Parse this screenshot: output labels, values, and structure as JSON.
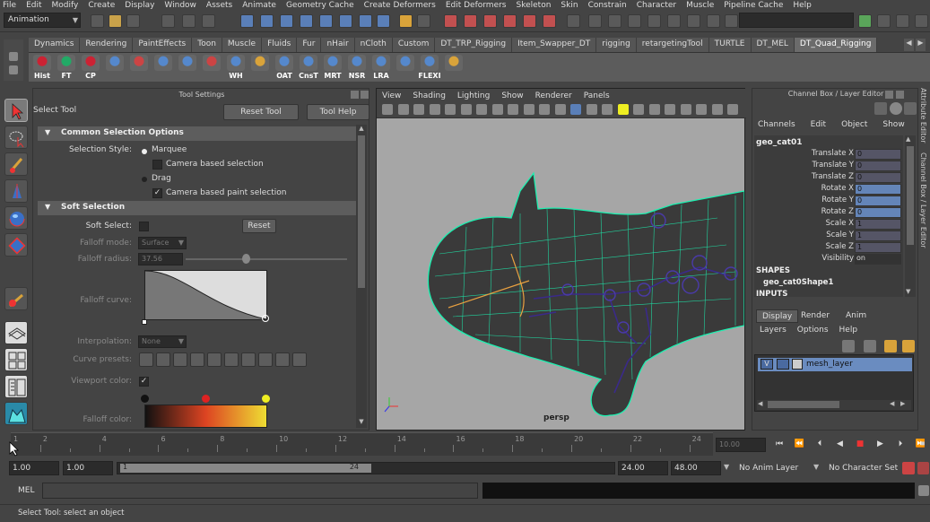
{
  "menubar": [
    "File",
    "Edit",
    "Modify",
    "Create",
    "Display",
    "Window",
    "Assets",
    "Animate",
    "Geometry Cache",
    "Create Deformers",
    "Edit Deformers",
    "Skeleton",
    "Skin",
    "Constrain",
    "Character",
    "Muscle",
    "Pipeline Cache",
    "Help"
  ],
  "status": {
    "mode": "Animation"
  },
  "shelf_tabs": [
    "Dynamics",
    "Rendering",
    "PaintEffects",
    "Toon",
    "Muscle",
    "Fluids",
    "Fur",
    "nHair",
    "nCloth",
    "Custom",
    "DT_TRP_Rigging",
    "Item_Swapper_DT",
    "rigging",
    "retargetingTool",
    "TURTLE",
    "DT_MEL",
    "DT_Quad_Rigging"
  ],
  "shelf_buttons": [
    "Hist",
    "FT",
    "CP",
    "",
    "",
    "",
    "",
    "",
    "WH",
    "",
    "OAT",
    "CnsT",
    "MRT",
    "NSR",
    "LRA",
    "",
    "FLEXI",
    ""
  ],
  "tool_settings": {
    "title": "Tool Settings",
    "tool_name": "Select Tool",
    "reset_btn": "Reset Tool",
    "help_btn": "Tool Help",
    "common_section": "Common Selection Options",
    "selection_style_label": "Selection Style:",
    "marquee": "Marquee",
    "camera_based": "Camera based selection",
    "drag": "Drag",
    "camera_paint": "Camera based paint selection",
    "soft_section": "Soft Selection",
    "soft_select_label": "Soft Select:",
    "reset_small": "Reset",
    "falloff_mode_label": "Falloff mode:",
    "falloff_mode_val": "Surface",
    "falloff_radius_label": "Falloff radius:",
    "falloff_radius_val": "37.56",
    "falloff_curve_label": "Falloff curve:",
    "interp_label": "Interpolation:",
    "interp_val": "None",
    "curve_presets_label": "Curve presets:",
    "viewport_color_label": "Viewport color:",
    "falloff_color_label": "Falloff color:"
  },
  "viewport": {
    "menu": [
      "View",
      "Shading",
      "Lighting",
      "Show",
      "Renderer",
      "Panels"
    ],
    "camera": "persp"
  },
  "channel_box": {
    "title": "Channel Box / Layer Editor",
    "menu": [
      "Channels",
      "Edit",
      "Object",
      "Show"
    ],
    "object": "geo_cat01",
    "attrs": [
      {
        "label": "Translate X",
        "value": "0"
      },
      {
        "label": "Translate Y",
        "value": "0"
      },
      {
        "label": "Translate Z",
        "value": "0"
      },
      {
        "label": "Rotate X",
        "value": "0"
      },
      {
        "label": "Rotate Y",
        "value": "0"
      },
      {
        "label": "Rotate Z",
        "value": "0"
      },
      {
        "label": "Scale X",
        "value": "1"
      },
      {
        "label": "Scale Y",
        "value": "1"
      },
      {
        "label": "Scale Z",
        "value": "1"
      },
      {
        "label": "Visibility",
        "value": "on"
      }
    ],
    "shapes_header": "SHAPES",
    "shape_name": "geo_cat0Shape1",
    "inputs_header": "INPUTS",
    "layer_tabs": [
      "Display",
      "Render",
      "Anim"
    ],
    "layer_menu": [
      "Layers",
      "Options",
      "Help"
    ],
    "layer_v": "V",
    "layer_name": "mesh_layer",
    "side_tabs": [
      "Attribute Editor",
      "Channel Box / Layer Editor"
    ]
  },
  "timeline": {
    "ticks": [
      "1",
      "2",
      "4",
      "6",
      "8",
      "10",
      "12",
      "14",
      "16",
      "18",
      "20",
      "22",
      "24"
    ],
    "current_time": "10.00",
    "range_start": "1.00",
    "playback_start": "1.00",
    "slider_start": "1",
    "slider_end": "24",
    "playback_end": "24.00",
    "range_end": "48.00",
    "anim_layer": "No Anim Layer",
    "character_set": "No Character Set"
  },
  "cmdline": {
    "label": "MEL"
  },
  "helpline": {
    "text": "Select Tool: select an object"
  }
}
